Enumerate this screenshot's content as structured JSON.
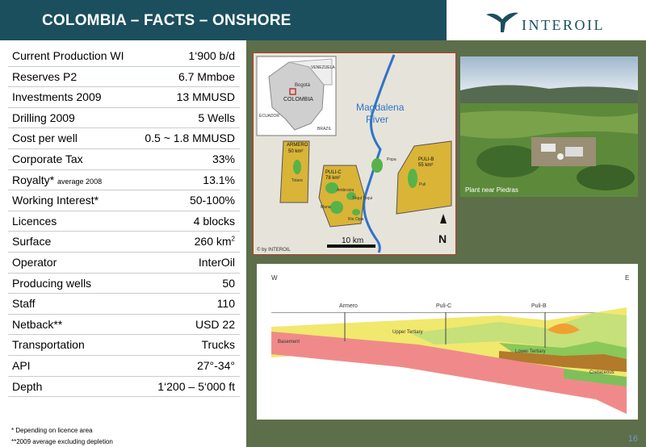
{
  "header": {
    "title": "COLOMBIA – FACTS – ONSHORE",
    "logo_text": "INTEROIL"
  },
  "facts": [
    {
      "label": "Current Production WI",
      "value": "1‘900 b/d"
    },
    {
      "label": "Reserves P2",
      "value": "6.7 Mmboe"
    },
    {
      "label": "Investments 2009",
      "value": "13 MMUSD"
    },
    {
      "label": "Drilling 2009",
      "value": "5 Wells"
    },
    {
      "label": "Cost per well",
      "value": "0.5 ~ 1.8 MMUSD"
    },
    {
      "label": "Corporate Tax",
      "value": "33%"
    },
    {
      "label": "Royalty*",
      "note": "average 2008",
      "value": "13.1%"
    },
    {
      "label": "Working Interest*",
      "value": "50-100%"
    },
    {
      "label": "Licences",
      "value": "4 blocks"
    },
    {
      "label": "Surface",
      "value": "260 km",
      "sup": "2"
    },
    {
      "label": "Operator",
      "value": "InterOil"
    },
    {
      "label": "Producing wells",
      "value": "50"
    },
    {
      "label": "Staff",
      "value": "110"
    },
    {
      "label": "Netback**",
      "value": "USD 22"
    },
    {
      "label": "Transportation",
      "value": "Trucks"
    },
    {
      "label": "API",
      "value": "27°-34°"
    },
    {
      "label": "Depth",
      "value": "1‘200 – 5‘000 ft"
    }
  ],
  "footnotes": [
    "* Depending on licence area",
    "**2009 average  excluding depletion"
  ],
  "page_number": "16",
  "map": {
    "countries": [
      "VENEZUELA",
      "Bogotá",
      "COLOMBIA",
      "ECUADOR",
      "BRAZIL"
    ],
    "river": [
      "Magdalena",
      "River"
    ],
    "blocks": [
      {
        "name": "ARMERO",
        "area": "50 km²"
      },
      {
        "name": "PULI-C",
        "area": "78 km²"
      },
      {
        "name": "PULI-B",
        "area": "55 km²"
      }
    ],
    "fields": [
      "Totare",
      "Ambrosia",
      "Toqui Toqui",
      "Mana",
      "Rio Opia",
      "Popa",
      "Puli"
    ],
    "scale": "10 km",
    "north": "N",
    "credit": "© by INTEROIL"
  },
  "photo": {
    "caption": "Plant near Piedras"
  },
  "section": {
    "west": "W",
    "east": "E",
    "labels": [
      "Armero",
      "Puli-C",
      "Puli-B",
      "Upper Tertiary",
      "Lower Tertiary",
      "Basement",
      "Cretaceous"
    ]
  },
  "colors": {
    "header": "#1b4f5e",
    "panel_bg": "#5d6e4a",
    "block_fill": "#d9b437",
    "field": "#57b24a",
    "river": "#2f74c8"
  }
}
